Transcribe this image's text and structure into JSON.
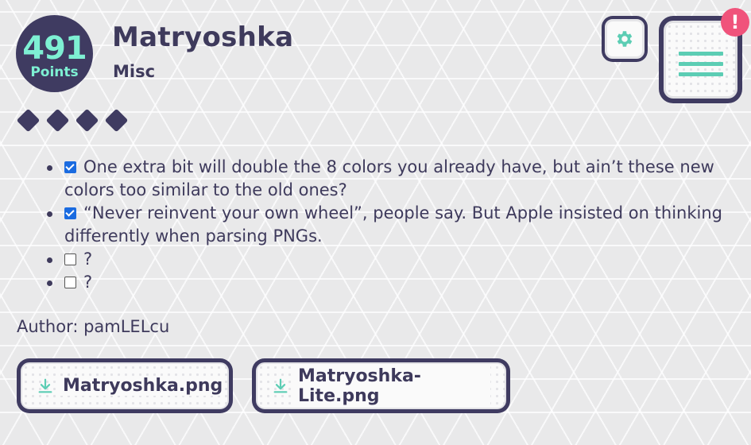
{
  "challenge": {
    "points_value": "491",
    "points_label": "Points",
    "title": "Matryoshka",
    "category": "Misc",
    "difficulty_diamonds": 4
  },
  "hints": [
    {
      "text": "One extra bit will double the 8 colors you already have, but ain’t these new colors too similar to the old ones?",
      "checked": true
    },
    {
      "text": "“Never reinvent your own wheel”, people say. But Apple insisted on thinking differently when parsing PNGs.",
      "checked": true
    },
    {
      "text": "?",
      "checked": false
    },
    {
      "text": "?",
      "checked": false
    }
  ],
  "author": "Author: pamLELcu",
  "files": [
    {
      "label": "Matryoshka.png",
      "icon": "download-icon"
    },
    {
      "label": "Matryoshka-Lite.png",
      "icon": "download-icon"
    }
  ],
  "header_buttons": {
    "settings_icon": "gear-icon",
    "menu_icon": "hamburger-icon",
    "alert_badge": "!"
  },
  "colors": {
    "accent": "#5ccdb4",
    "dark": "#3f3b61",
    "points_text": "#7ef0d3",
    "alert": "#f0537b",
    "checkbox": "#1a6be0"
  }
}
